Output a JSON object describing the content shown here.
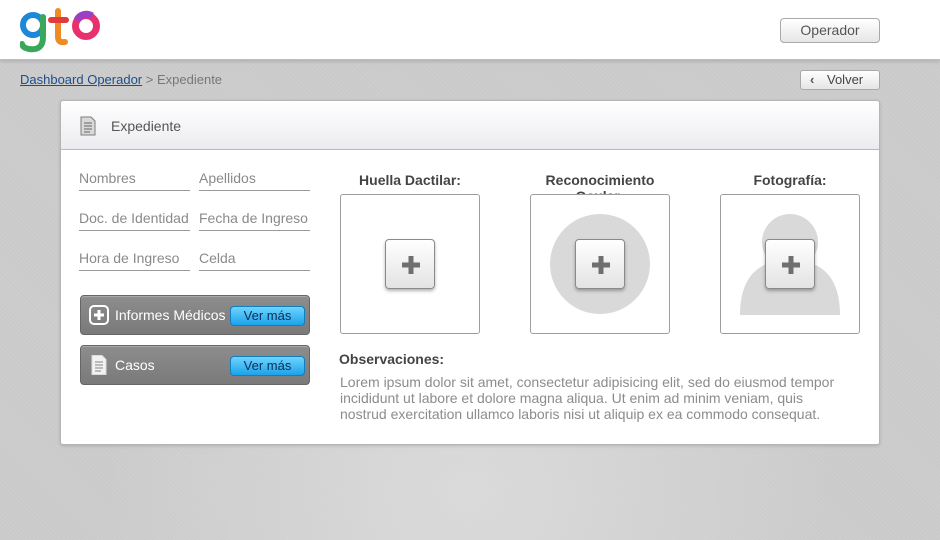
{
  "header": {
    "logo_text": "gto",
    "operator_button": "Operador"
  },
  "breadcrumb": {
    "link": "Dashboard Operador",
    "separator": ">",
    "current": "Expediente"
  },
  "back_button": {
    "label": "Volver",
    "icon": "chevron-left-icon"
  },
  "panel": {
    "title": "Expediente",
    "title_icon": "document-icon"
  },
  "fields": {
    "nombres": "Nombres",
    "apellidos": "Apellidos",
    "doc_identidad": "Doc. de Identidad",
    "fecha_ingreso": "Fecha de Ingreso",
    "hora_ingreso": "Hora de Ingreso",
    "celda": "Celda"
  },
  "actions": [
    {
      "label": "Informes Médicos",
      "icon": "plus-square-icon",
      "button": "Ver más"
    },
    {
      "label": "Casos",
      "icon": "document-icon",
      "button": "Ver más"
    }
  ],
  "captures": {
    "fingerprint": "Huella Dactilar:",
    "eye": "Reconocimiento Ocular:",
    "photo": "Fotografía:"
  },
  "observations": {
    "label": "Observaciones:",
    "text": "Lorem ipsum dolor sit amet, consectetur adipisicing elit, sed do eiusmod tempor incididunt ut labore et dolore magna aliqua. Ut enim ad minim veniam, quis nostrud exercitation ullamco laboris nisi ut aliquip ex ea commodo consequat."
  },
  "colors": {
    "accent_button": "#1ba3ea",
    "link": "#1c4e8a",
    "logo_g": "#1e88d8",
    "logo_t": "#f08a24",
    "logo_o": "#e8306f"
  }
}
